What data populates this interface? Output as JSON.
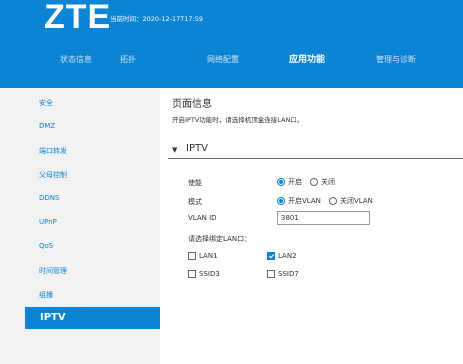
{
  "header": {
    "logo": "ZTE",
    "time": "当前时间：2020-12-17T17:59"
  },
  "nav": {
    "items": [
      "状态信息",
      "拓扑",
      "网络配置",
      "应用功能",
      "管理与诊断"
    ],
    "active": "应用功能"
  },
  "sidebar": {
    "items": [
      "安全",
      "DMZ",
      "端口转发",
      "父母控制",
      "DDNS",
      "UPnP",
      "QoS",
      "时间管理",
      "组播"
    ],
    "active": "IPTV"
  },
  "main": {
    "title": "页面信息",
    "description": "开启IPTV功能时，请选择机顶盒连接LAN口。",
    "section": "IPTV"
  },
  "form": {
    "enable_label": "使能",
    "enable_on": "开启",
    "enable_off": "关闭",
    "enable_value": "开启",
    "mode_label": "模式",
    "mode_on": "开启VLAN",
    "mode_off": "关闭VLAN",
    "mode_value": "开启VLAN",
    "vlan_label": "VLAN ID",
    "vlan_value": "3801",
    "lan_prompt": "请选择绑定LAN口：",
    "ports": [
      {
        "label": "LAN1",
        "checked": false
      },
      {
        "label": "LAN2",
        "checked": true
      },
      {
        "label": "SSID3",
        "checked": false
      },
      {
        "label": "SSID7",
        "checked": false
      }
    ]
  },
  "colors": {
    "accent": "#0b84d3",
    "sidebar_bg": "#f2f2f2"
  }
}
